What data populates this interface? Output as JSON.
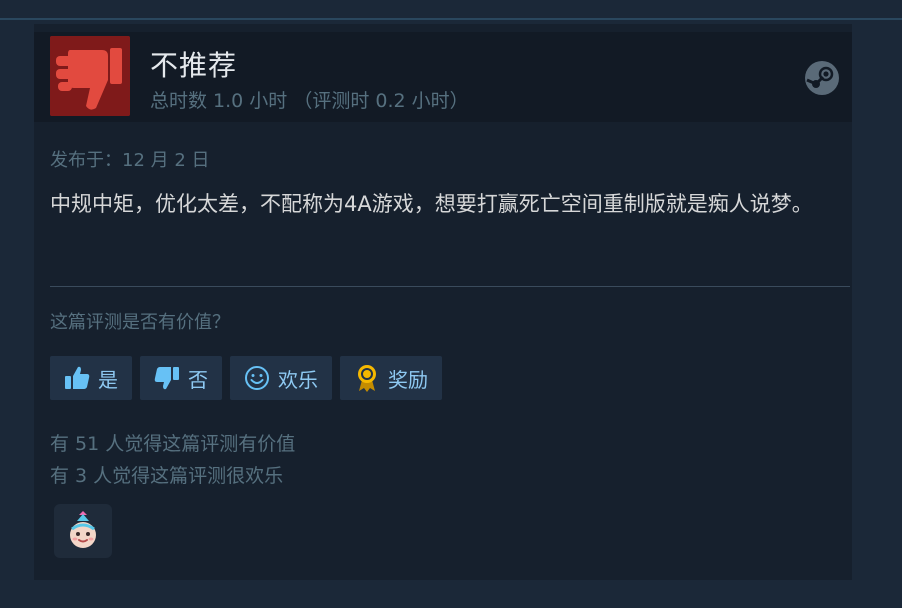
{
  "review": {
    "verdict": "不推荐",
    "hours_text": "总时数 1.0 小时  （评测时 0.2 小时）",
    "posted": "发布于：12 月 2 日",
    "body": "中规中矩，优化太差，不配称为4A游戏，想要打赢死亡空间重制版就是痴人说梦。",
    "question": "这篇评测是否有价值？",
    "buttons": {
      "yes": "是",
      "no": "否",
      "funny": "欢乐",
      "award": "奖励"
    },
    "helpful_count_text": "有 51 人觉得这篇评测有价值",
    "funny_count_text": "有 3 人觉得这篇评测很欢乐"
  },
  "icons": {
    "verdict": "thumbs-down-icon",
    "platform": "steam-icon",
    "yes": "thumbs-up-icon",
    "no": "thumbs-down-icon",
    "funny": "smiley-icon",
    "award": "award-ribbon-icon",
    "reaction": "party-face-sticker-icon"
  },
  "colors": {
    "page_bg": "#1b2838",
    "card_bg": "#16202d",
    "header_bg": "#121a25",
    "not_recommended": "#7f1a1a",
    "thumb_red": "#e24a3f",
    "button_bg": "#223246",
    "button_text": "#67c1f5",
    "award_gold": "#f5b800"
  }
}
